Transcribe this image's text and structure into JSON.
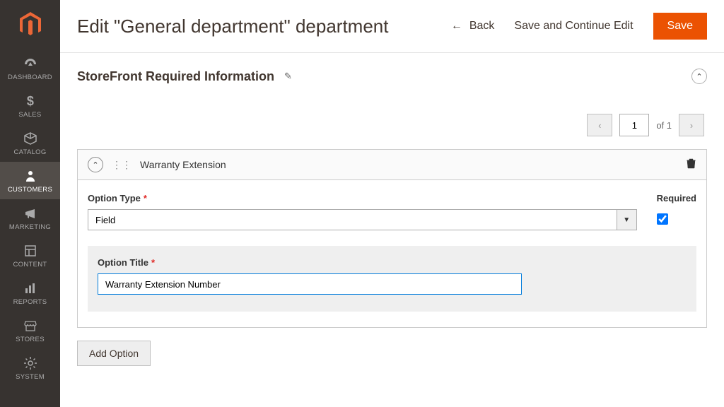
{
  "sidebar": {
    "items": [
      {
        "label": "DASHBOARD",
        "icon": "dashboard"
      },
      {
        "label": "SALES",
        "icon": "dollar"
      },
      {
        "label": "CATALOG",
        "icon": "box"
      },
      {
        "label": "CUSTOMERS",
        "icon": "person",
        "active": true
      },
      {
        "label": "MARKETING",
        "icon": "megaphone"
      },
      {
        "label": "CONTENT",
        "icon": "layout"
      },
      {
        "label": "REPORTS",
        "icon": "bars"
      },
      {
        "label": "STORES",
        "icon": "store"
      },
      {
        "label": "SYSTEM",
        "icon": "gear"
      }
    ]
  },
  "header": {
    "title": "Edit \"General department\" department",
    "back_label": "Back",
    "save_continue_label": "Save and Continue Edit",
    "save_label": "Save"
  },
  "section": {
    "title": "StoreFront Required Information"
  },
  "pagination": {
    "current": "1",
    "of_label": "of 1"
  },
  "option_block": {
    "name": "Warranty Extension",
    "option_type_label": "Option Type",
    "option_type_value": "Field",
    "required_label": "Required",
    "required_checked": true,
    "option_title_label": "Option Title",
    "option_title_value": "Warranty Extension Number"
  },
  "add_option_label": "Add Option"
}
